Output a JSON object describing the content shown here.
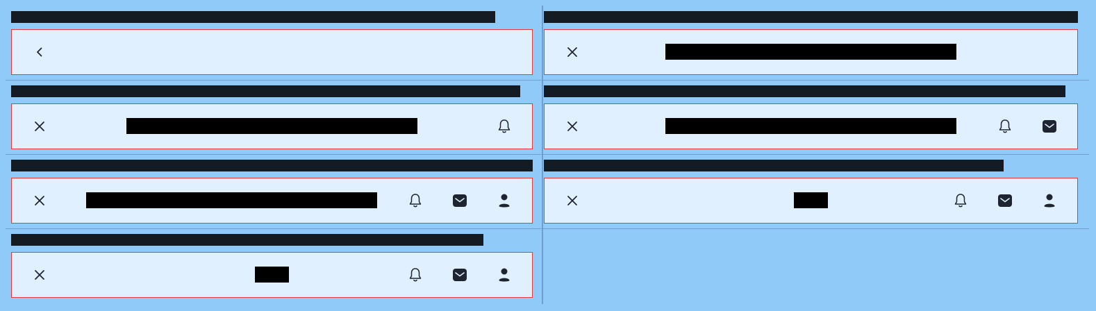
{
  "colors": {
    "page_background": "#90caf9",
    "navbar_background": "#e0f0fe",
    "navbar_border": "#e53935",
    "redaction": "#000000",
    "caption_bar": "#151b23",
    "icon": "#1e2430"
  },
  "variants": [
    {
      "caption": "",
      "title": "",
      "leading_icon": "chevron-left-icon",
      "trailing_icons": []
    },
    {
      "caption": "",
      "title": "",
      "leading_icon": "close-icon",
      "trailing_icons": []
    },
    {
      "caption": "",
      "title": "",
      "leading_icon": "close-icon",
      "trailing_icons": [
        "bell-icon"
      ]
    },
    {
      "caption": "",
      "title": "",
      "leading_icon": "close-icon",
      "trailing_icons": [
        "bell-icon",
        "mail-icon"
      ]
    },
    {
      "caption": "",
      "title": "",
      "leading_icon": "close-icon",
      "trailing_icons": [
        "bell-icon",
        "mail-icon",
        "person-icon"
      ]
    },
    {
      "caption": "",
      "title": "",
      "leading_icon": "close-icon",
      "trailing_icons": [
        "bell-icon",
        "mail-icon",
        "person-icon"
      ]
    },
    {
      "caption": "",
      "title": "",
      "leading_icon": "close-icon",
      "trailing_icons": [
        "bell-icon",
        "mail-icon",
        "person-icon"
      ]
    }
  ]
}
